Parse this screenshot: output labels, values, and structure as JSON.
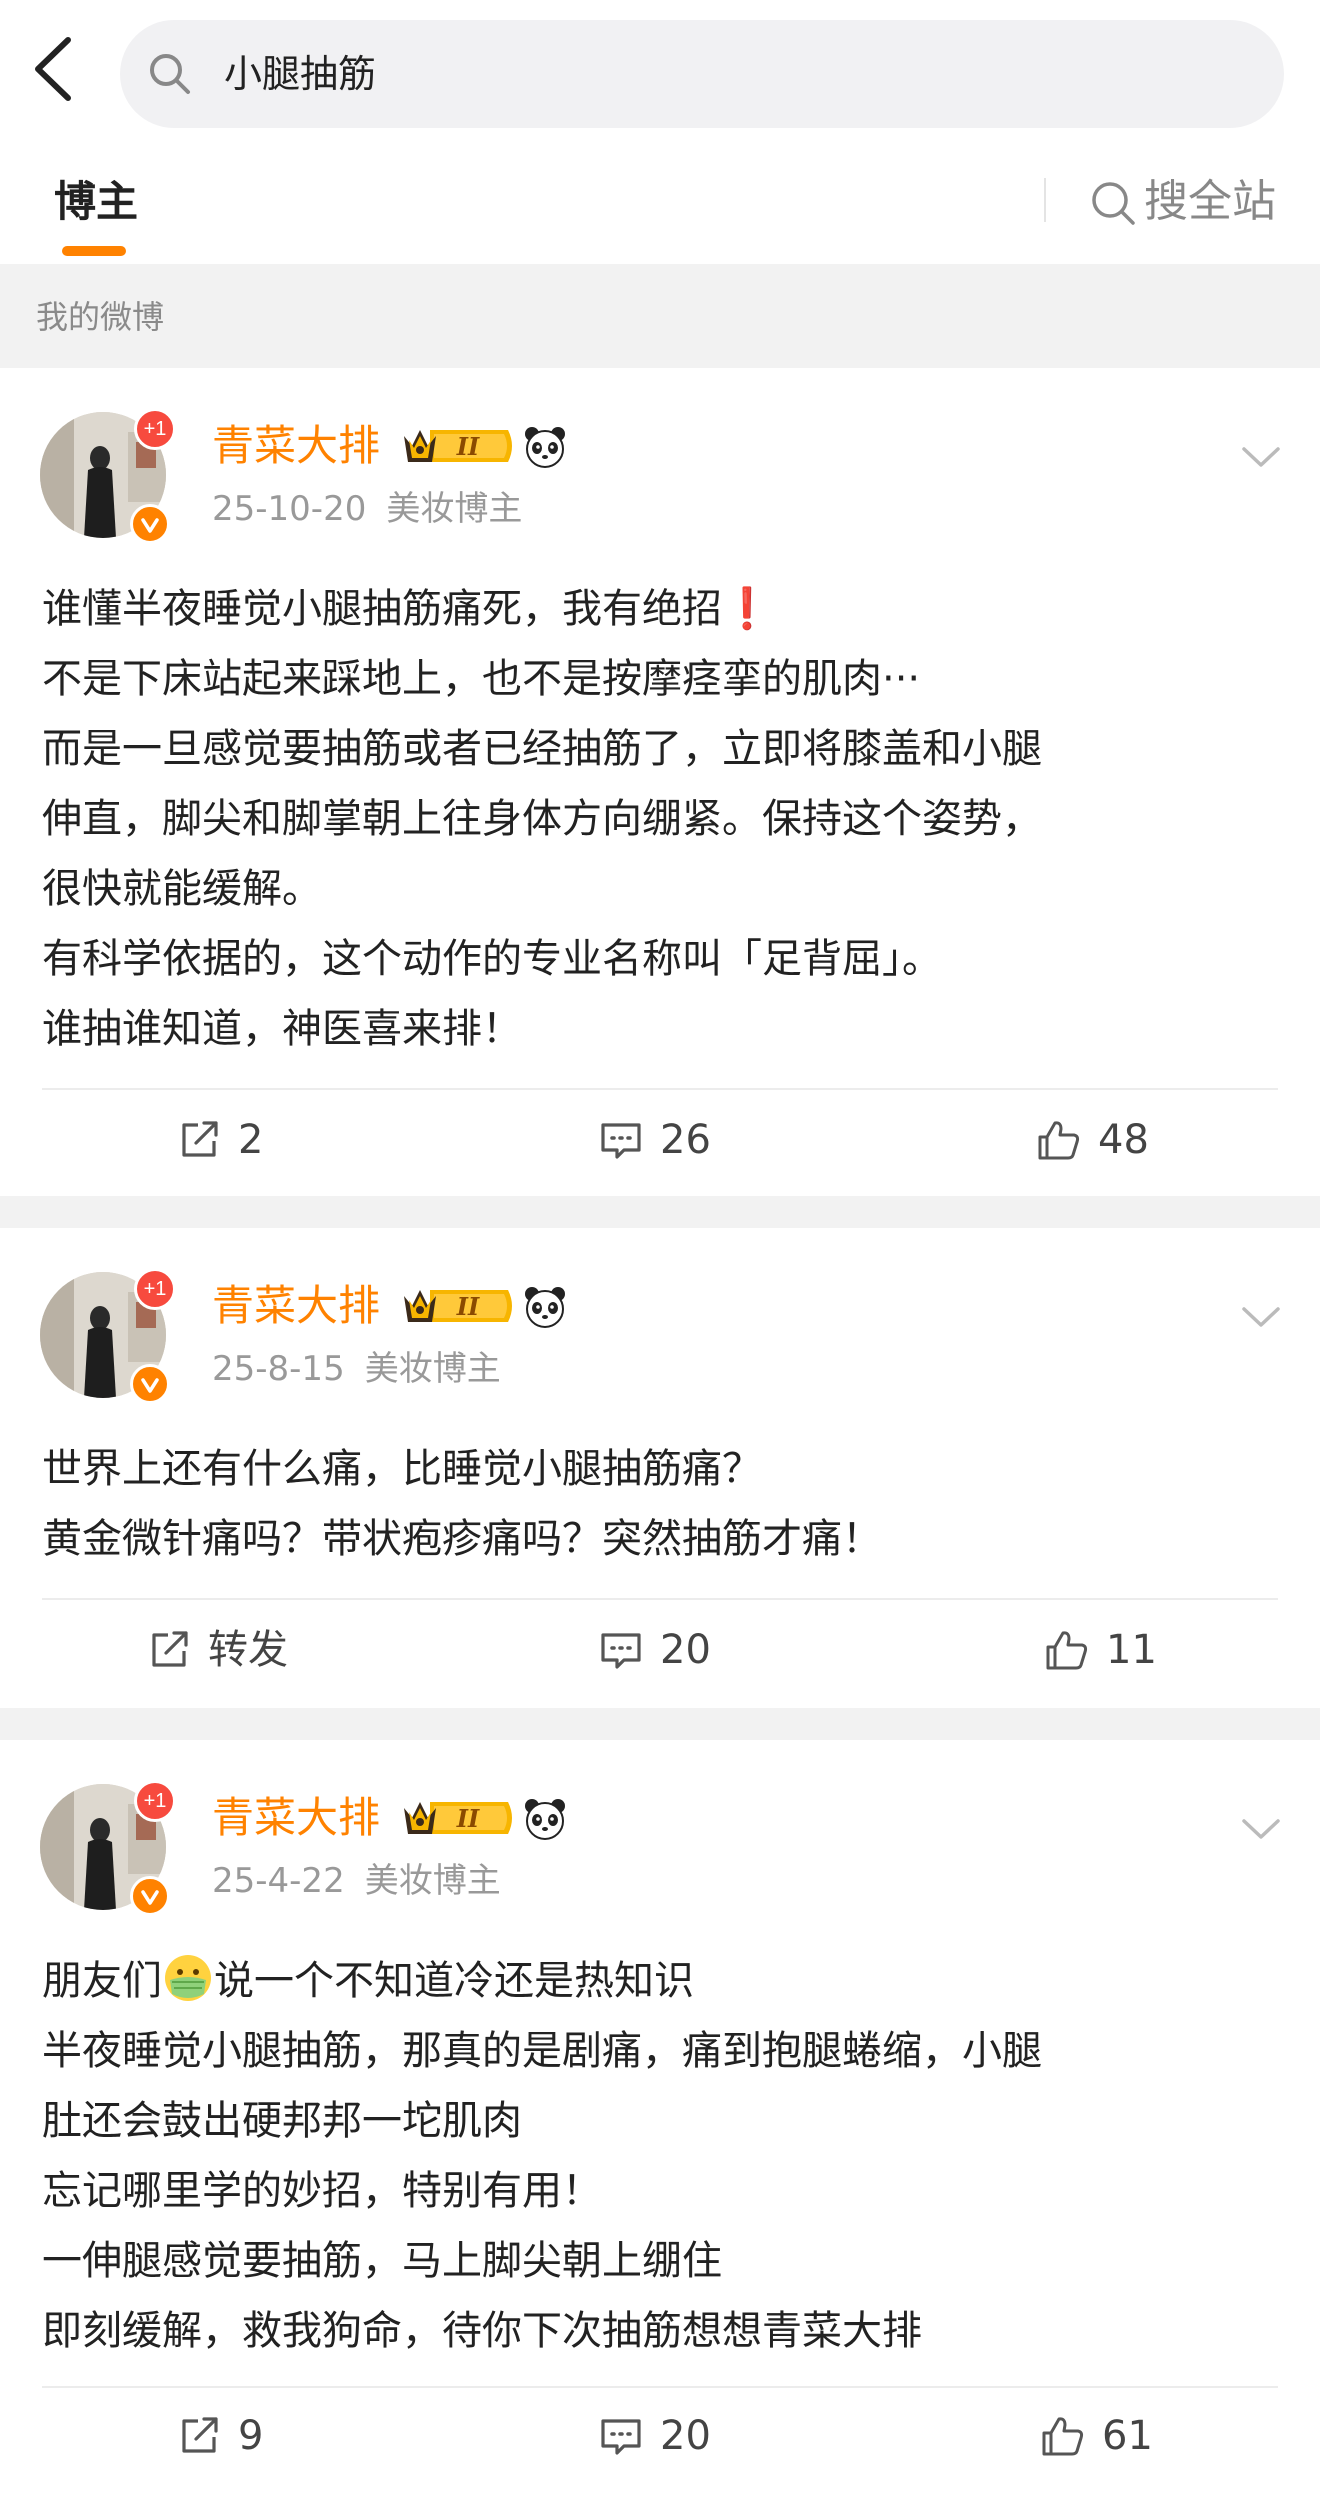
{
  "search": {
    "query": "小腿抽筋"
  },
  "tabs": {
    "active": "博主",
    "site_search": "搜全站"
  },
  "section": {
    "label": "我的微博"
  },
  "colors": {
    "accent": "#ff8200",
    "muted": "#999999",
    "badge_red": "#f74a3e"
  },
  "posts": [
    {
      "author": "青菜大排",
      "date": "25-10-20",
      "tag": "美妆博主",
      "avatar_badge": "+1",
      "lines": [
        "谁懂半夜睡觉小腿抽筋痛死，我有绝招❗️",
        "不是下床站起来踩地上，也不是按摩痉挛的肌肉···",
        "而是一旦感觉要抽筋或者已经抽筋了，立即将膝盖和小腿",
        "伸直，脚尖和脚掌朝上往身体方向绷紧。保持这个姿势，",
        "很快就能缓解。",
        "有科学依据的，这个动作的专业名称叫「足背屈」。",
        "谁抽谁知道，神医喜来排！"
      ],
      "repost": "2",
      "comments": "26",
      "likes": "48"
    },
    {
      "author": "青菜大排",
      "date": "25-8-15",
      "tag": "美妆博主",
      "avatar_badge": "+1",
      "lines": [
        "世界上还有什么痛，比睡觉小腿抽筋痛？",
        "黄金微针痛吗？带状疱疹痛吗？突然抽筋才痛！"
      ],
      "repost": "转发",
      "comments": "20",
      "likes": "11"
    },
    {
      "author": "青菜大排",
      "date": "25-4-22",
      "tag": "美妆博主",
      "avatar_badge": "+1",
      "line1_before": "朋友们",
      "line1_after": "说一个不知道冷还是热知识",
      "lines": [
        "半夜睡觉小腿抽筋，那真的是剧痛，痛到抱腿蜷缩，小腿",
        "肚还会鼓出硬邦邦一坨肌肉",
        "忘记哪里学的妙招，特别有用！",
        "一伸腿感觉要抽筋，马上脚尖朝上绷住",
        "即刻缓解，救我狗命，待你下次抽筋想想青菜大排"
      ],
      "repost": "9",
      "comments": "20",
      "likes": "61"
    }
  ]
}
